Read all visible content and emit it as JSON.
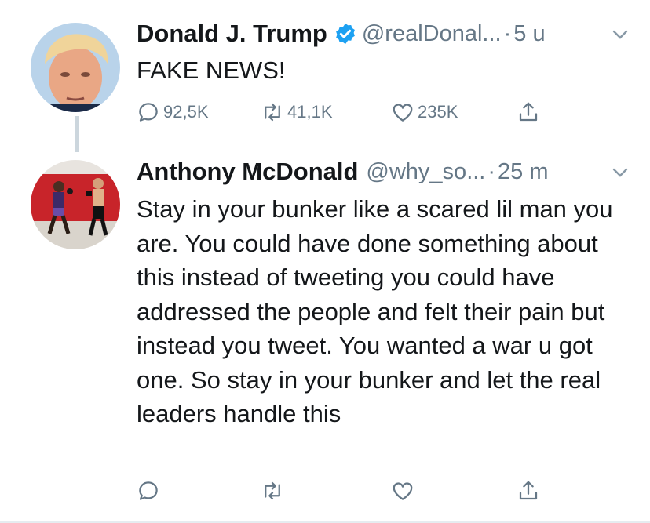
{
  "tweets": [
    {
      "author": "Donald J. Trump",
      "handle": "@realDonal...",
      "separator": "·",
      "time": "5 u",
      "verified": true,
      "text": "FAKE NEWS!",
      "reply_count": "92,5K",
      "retweet_count": "41,1K",
      "like_count": "235K"
    },
    {
      "author": "Anthony McDonald",
      "handle": "@why_so...",
      "separator": "·",
      "time": "25 m",
      "verified": false,
      "text": "Stay in your bunker like a scared lil man you are. You could have done something about this instead of tweeting you could have addressed the people and felt their pain but instead you tweet. You wanted a war u got one. So stay in your bunker and let the real leaders handle this"
    }
  ],
  "icons": {
    "reply": "reply-icon",
    "retweet": "retweet-icon",
    "like": "heart-icon",
    "share": "share-icon",
    "verified": "verified-badge-icon",
    "more": "chevron-down-icon"
  },
  "colors": {
    "text": "#14171a",
    "secondary": "#657786",
    "verified_blue": "#1da1f2",
    "thread_line": "#ccd6dd"
  }
}
